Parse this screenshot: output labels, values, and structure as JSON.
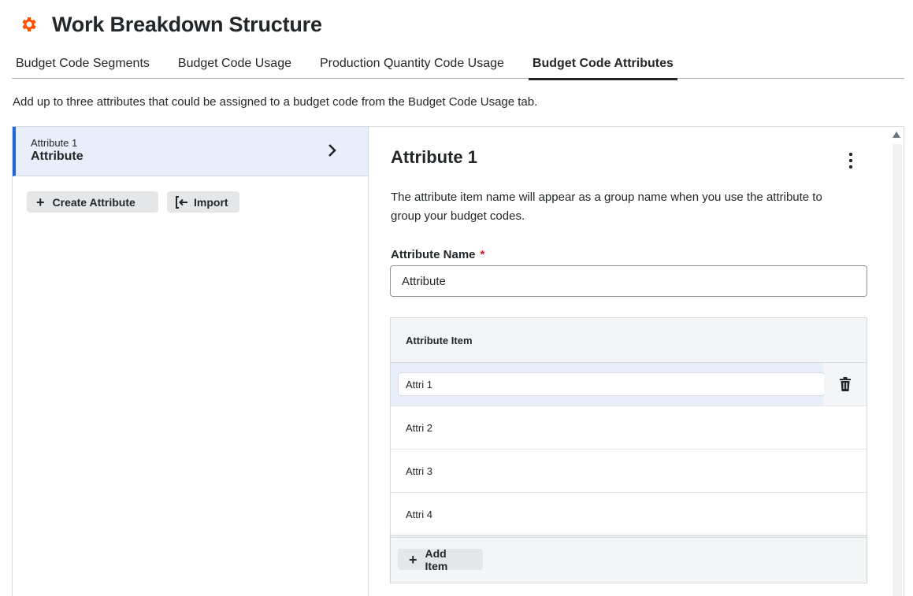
{
  "header": {
    "title": "Work Breakdown Structure",
    "icon": "gear-icon",
    "icon_color": "#ff5200"
  },
  "tabs": [
    {
      "label": "Budget Code Segments",
      "active": false
    },
    {
      "label": "Budget Code Usage",
      "active": false
    },
    {
      "label": "Production Quantity Code Usage",
      "active": false
    },
    {
      "label": "Budget Code Attributes",
      "active": true
    }
  ],
  "description": "Add up to three attributes that could be assigned to a budget code from the Budget Code Usage tab.",
  "sidebar": {
    "selected_item": {
      "caption": "Attribute 1",
      "name": "Attribute"
    },
    "create_label": "Create Attribute",
    "import_label": "Import"
  },
  "detail": {
    "title": "Attribute 1",
    "description": "The attribute item name will appear as a group name when you use the attribute to group your budget codes.",
    "name_label": "Attribute Name",
    "required_mark": "*",
    "name_value": "Attribute",
    "table": {
      "header": "Attribute Item",
      "rows": [
        "Attri 1",
        "Attri 2",
        "Attri 3",
        "Attri 4"
      ],
      "add_label": "Add Item"
    }
  },
  "colors": {
    "accent": "#2066df",
    "selected_bg": "#e8effa",
    "required": "#d8141b"
  }
}
